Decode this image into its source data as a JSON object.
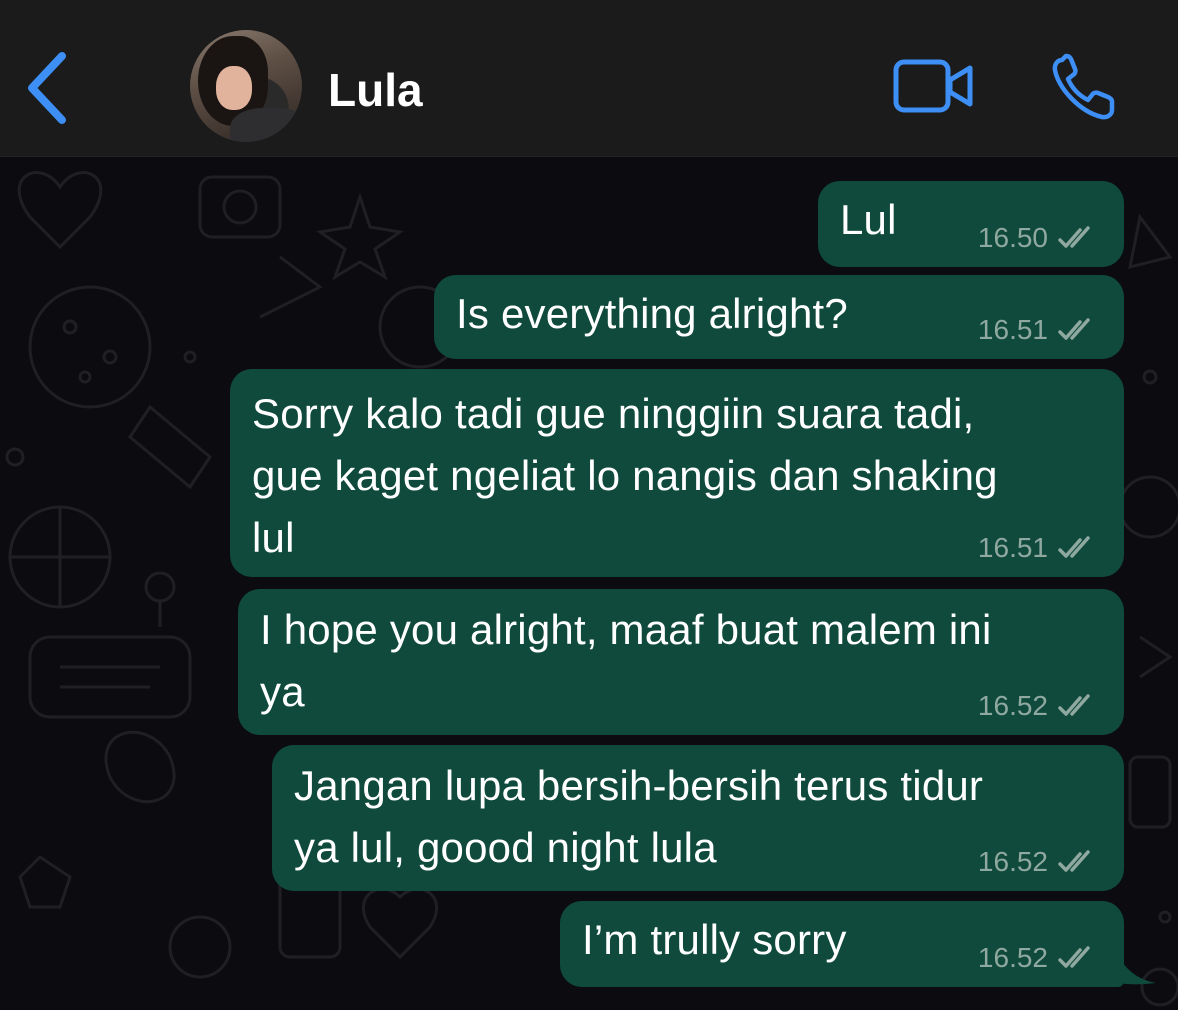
{
  "header": {
    "contact_name": "Lula",
    "back_icon": "chevron-left-icon",
    "video_icon": "video-camera-icon",
    "call_icon": "phone-icon",
    "accent_color": "#3e8ff5"
  },
  "theme": {
    "outgoing_bubble": "#0f4a3c",
    "timestamp_color": "#8fa8a0",
    "background": "#0c0b0f"
  },
  "messages": [
    {
      "text": "Lul",
      "time": "16.50",
      "status": "double-check-icon"
    },
    {
      "text": "Is everything alright?",
      "time": "16.51",
      "status": "double-check-icon"
    },
    {
      "lines": [
        "Sorry kalo tadi gue ninggiin suara tadi,",
        "gue kaget ngeliat lo nangis dan shaking",
        "lul"
      ],
      "time": "16.51",
      "status": "double-check-icon"
    },
    {
      "lines": [
        "I hope you alright, maaf buat malem ini",
        "ya"
      ],
      "time": "16.52",
      "status": "double-check-icon"
    },
    {
      "lines": [
        "Jangan lupa bersih-bersih terus tidur",
        "ya lul, goood night lula"
      ],
      "time": "16.52",
      "status": "double-check-icon"
    },
    {
      "text": "I’m trully sorry",
      "time": "16.52",
      "status": "double-check-icon"
    }
  ]
}
